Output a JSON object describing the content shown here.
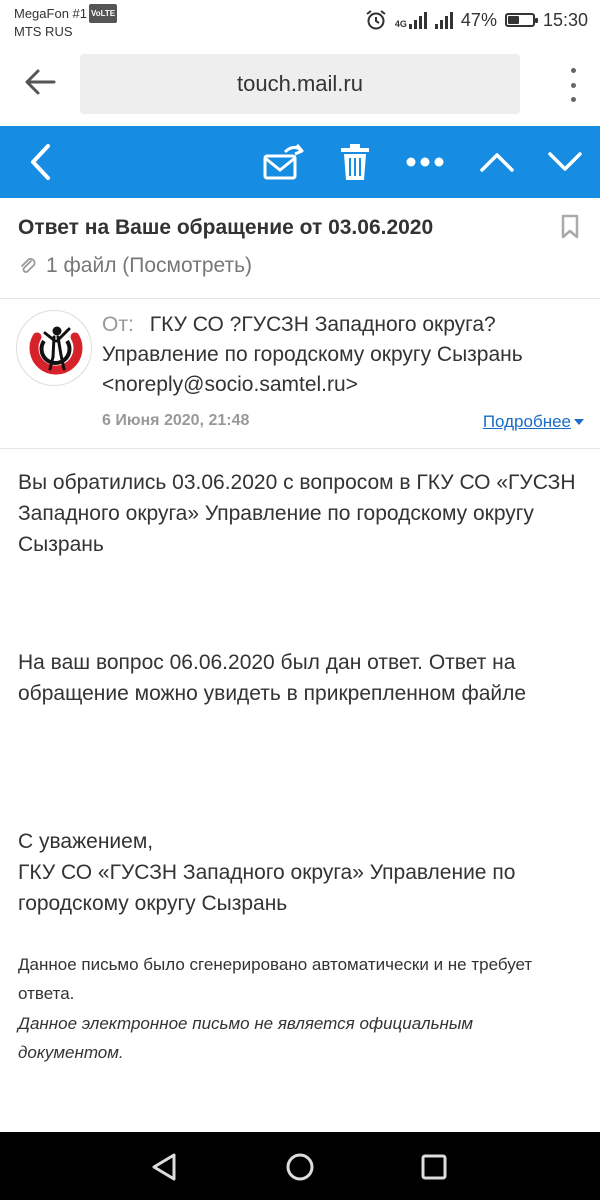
{
  "status_bar": {
    "carrier_primary": "MegaFon #1",
    "volte_badge": "VoLTE",
    "carrier_secondary": "MTS RUS",
    "network_label": "4G",
    "battery_percent": "47%",
    "battery_level": 0.47,
    "time": "15:30"
  },
  "browser": {
    "url": "touch.mail.ru"
  },
  "message": {
    "subject": "Ответ на Ваше обращение от 03.06.2020",
    "attachment_text": "1 файл (Посмотреть)",
    "from_label": "От:",
    "from_value": "ГКУ СО ?ГУСЗН Западного округа? Управление по городскому округу Сызрань <noreply@socio.samtel.ru>",
    "date": "6 Июня 2020, 21:48",
    "details_link": "Подробнее"
  },
  "body": {
    "paragraph_1": "Вы обратились 03.06.2020 с вопросом в ГКУ СО «ГУСЗН Западного округа» Управление по городскому округу Сызрань",
    "paragraph_2": "На ваш вопрос 06.06.2020 был дан ответ. Ответ на обращение можно увидеть в прикрепленном файле",
    "signature_line_1": "С уважением,",
    "signature_line_2": "ГКУ СО «ГУСЗН Западного округа» Управление по городскому округу Сызрань",
    "note_auto": "Данное письмо было сгенерировано автоматически и не требует ответа.",
    "note_official": "Данное электронное письмо не является официальным документом."
  },
  "colors": {
    "toolbar_blue": "#168de2",
    "link_blue": "#1a6dc7",
    "avatar_red": "#d7212b"
  }
}
